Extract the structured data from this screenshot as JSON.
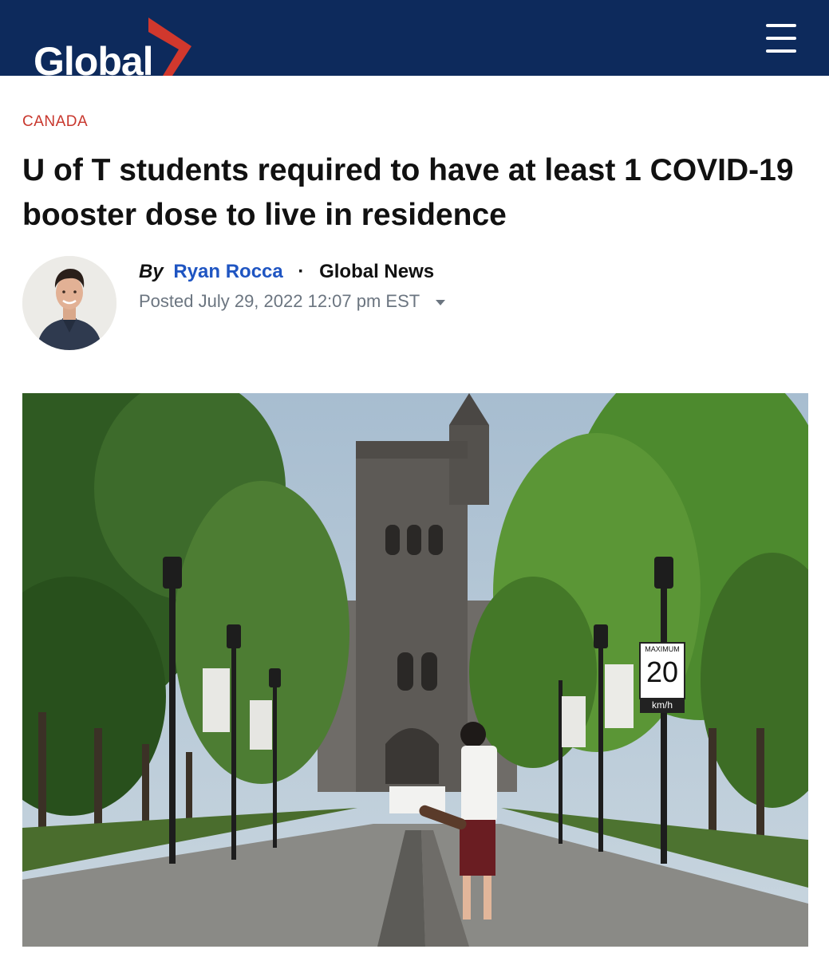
{
  "header": {
    "logo_text": "Global",
    "menu_icon": "hamburger-menu-icon",
    "background_color": "#0d2a5c",
    "accent_color": "#d1382d"
  },
  "article": {
    "category": "CANADA",
    "headline": "U of T students required to have at least 1 COVID-19 booster dose to live in residence",
    "byline": {
      "by": "By",
      "author": "Ryan Rocca",
      "separator": "·",
      "outlet": "Global News"
    },
    "posted": "Posted July 29, 2022 12:07 pm EST"
  },
  "photo": {
    "speed_sign_top": "MAXIMUM",
    "speed_sign_value": "20",
    "speed_sign_unit": "km/h"
  }
}
